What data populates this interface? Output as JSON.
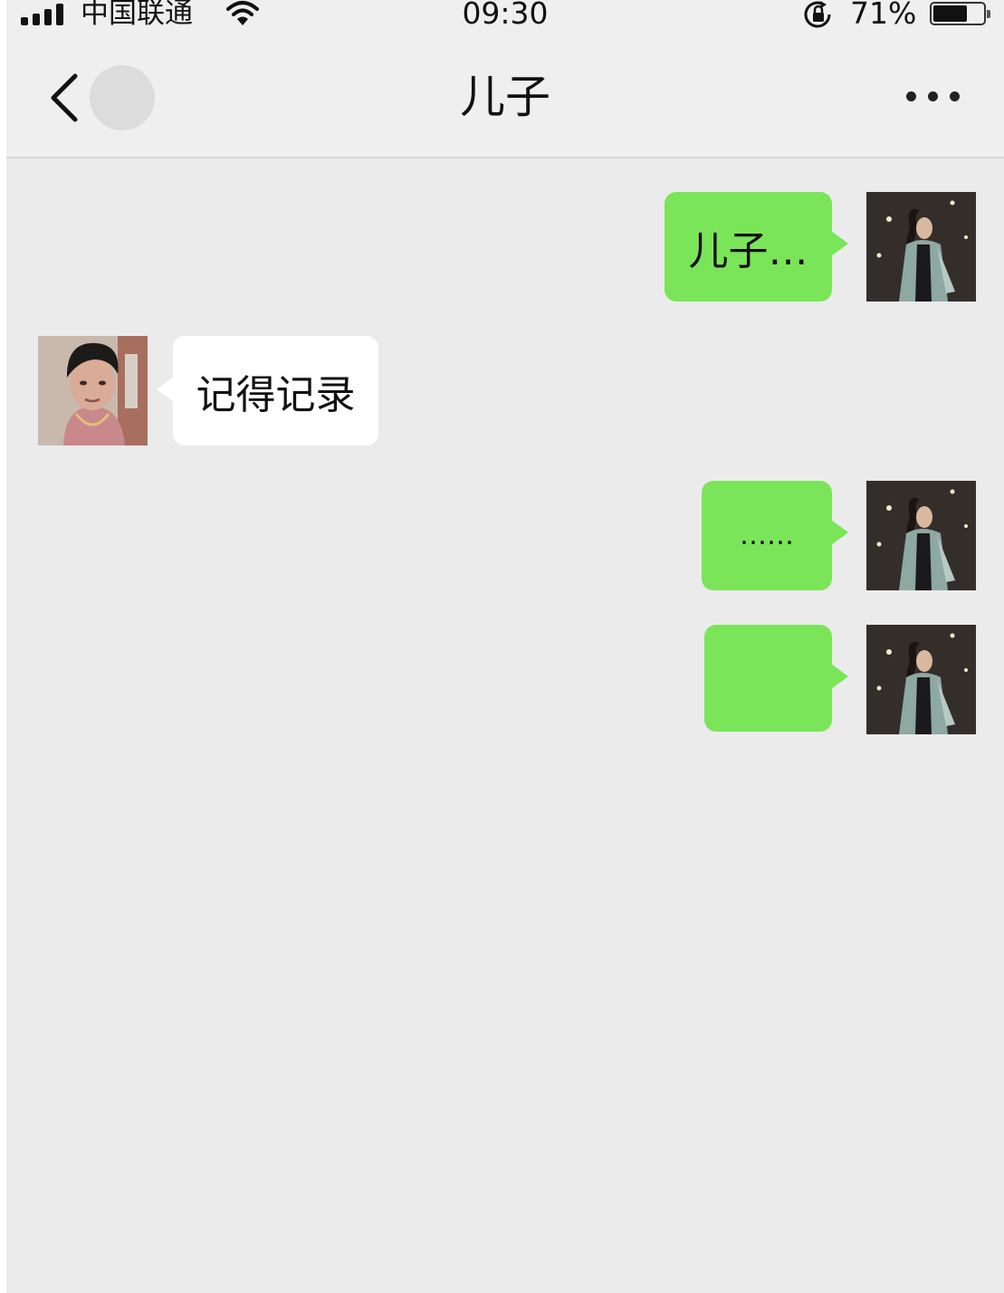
{
  "status_bar": {
    "carrier": "中国联通",
    "time": "09:30",
    "battery_percent": "71%",
    "battery_level": 0.71,
    "icons": [
      "signal-icon",
      "wifi-icon",
      "rotation-lock-icon",
      "battery-icon"
    ]
  },
  "header": {
    "title": "儿子",
    "back_icon": "chevron-left-icon",
    "more_icon": "more-dots-icon"
  },
  "messages": [
    {
      "direction": "outgoing",
      "text": "儿子…"
    },
    {
      "direction": "incoming",
      "text": "记得记录"
    },
    {
      "direction": "outgoing",
      "text": "……"
    },
    {
      "direction": "outgoing",
      "text": ""
    }
  ],
  "colors": {
    "outgoing_bubble": "#7be559",
    "incoming_bubble": "#ffffff",
    "chat_background": "#ebebeb",
    "header_background": "#efefef"
  }
}
